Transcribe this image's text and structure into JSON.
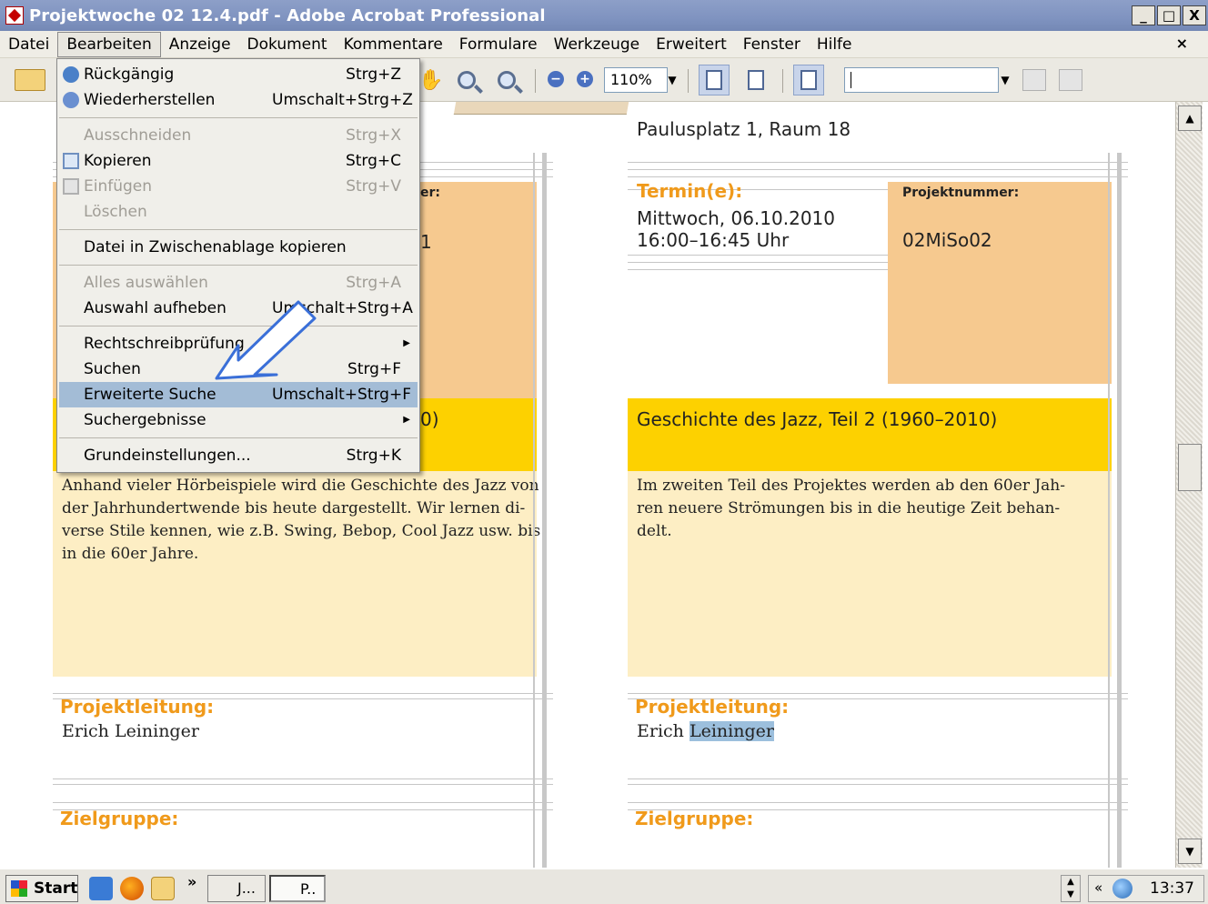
{
  "window": {
    "title": "Projektwoche 02 12.4.pdf - Adobe Acrobat Professional",
    "controls": [
      "_",
      "□",
      "X"
    ]
  },
  "menubar": {
    "items": [
      "Datei",
      "Bearbeiten",
      "Anzeige",
      "Dokument",
      "Kommentare",
      "Formulare",
      "Werkzeuge",
      "Erweitert",
      "Fenster",
      "Hilfe"
    ],
    "close_doc": "×"
  },
  "toolbar": {
    "zoom": "110%",
    "search_value": ""
  },
  "edit_menu": {
    "items": [
      {
        "label": "Rückgängig",
        "shortcut": "Strg+Z",
        "enabled": true
      },
      {
        "label": "Wiederherstellen",
        "shortcut": "Umschalt+Strg+Z",
        "enabled": true
      },
      {
        "label": "Ausschneiden",
        "shortcut": "Strg+X",
        "enabled": false
      },
      {
        "label": "Kopieren",
        "shortcut": "Strg+C",
        "enabled": true
      },
      {
        "label": "Einfügen",
        "shortcut": "Strg+V",
        "enabled": false
      },
      {
        "label": "Löschen",
        "shortcut": "",
        "enabled": false
      },
      {
        "label": "Datei in Zwischenablage kopieren",
        "shortcut": "",
        "enabled": true
      },
      {
        "label": "Alles auswählen",
        "shortcut": "Strg+A",
        "enabled": false
      },
      {
        "label": "Auswahl aufheben",
        "shortcut": "Umschalt+Strg+A",
        "enabled": true
      },
      {
        "label": "Rechtschreibprüfung",
        "shortcut": "",
        "enabled": true,
        "submenu": true
      },
      {
        "label": "Suchen",
        "shortcut": "Strg+F",
        "enabled": true
      },
      {
        "label": "Erweiterte Suche",
        "shortcut": "Umschalt+Strg+F",
        "enabled": true,
        "selected": true
      },
      {
        "label": "Suchergebnisse",
        "shortcut": "",
        "enabled": true,
        "submenu": true
      },
      {
        "label": "Grundeinstellungen...",
        "shortcut": "Strg+K",
        "enabled": true
      }
    ]
  },
  "document": {
    "left": {
      "frag_label": "er:",
      "frag_value": "1",
      "frag_title": "0)",
      "description": [
        "Anhand vieler Hörbeispiele wird die Geschichte des Jazz von",
        "der Jahrhundertwende bis heute dargestellt. Wir lernen di-",
        "verse Stile kennen, wie z.B. Swing, Bebop, Cool Jazz usw. bis",
        "in die 60er Jahre."
      ],
      "leader_label": "Projektleitung:",
      "leader_name": "Erich Leininger",
      "audience_label": "Zielgruppe:"
    },
    "right": {
      "location": "Paulusplatz 1, Raum 18",
      "date_label": "Termin(e):",
      "date_line1": "Mittwoch, 06.10.2010",
      "date_line2": "16:00–16:45 Uhr",
      "project_no_label": "Projektnummer:",
      "project_no": "02MiSo02",
      "title": "Geschichte des Jazz, Teil 2 (1960–2010)",
      "description": [
        "Im zweiten Teil des Projektes werden ab den 60er Jah-",
        "ren neuere Strömungen bis in die heutige Zeit behan-",
        "delt."
      ],
      "leader_label": "Projektleitung:",
      "leader_first": "Erich",
      "leader_last": "Leininger",
      "audience_label": "Zielgruppe:"
    }
  },
  "taskbar": {
    "start": "Start",
    "chevron": "»",
    "task1": "J...",
    "task2": "P..",
    "tray_chevron": "«",
    "clock": "13:37"
  },
  "colors": {
    "accent_orange": "#f09a1b",
    "box_orange": "#f6c98f",
    "title_yellow": "#fdd100",
    "desc_cream": "#fdeec4",
    "menu_selected": "#a3bcd6"
  }
}
